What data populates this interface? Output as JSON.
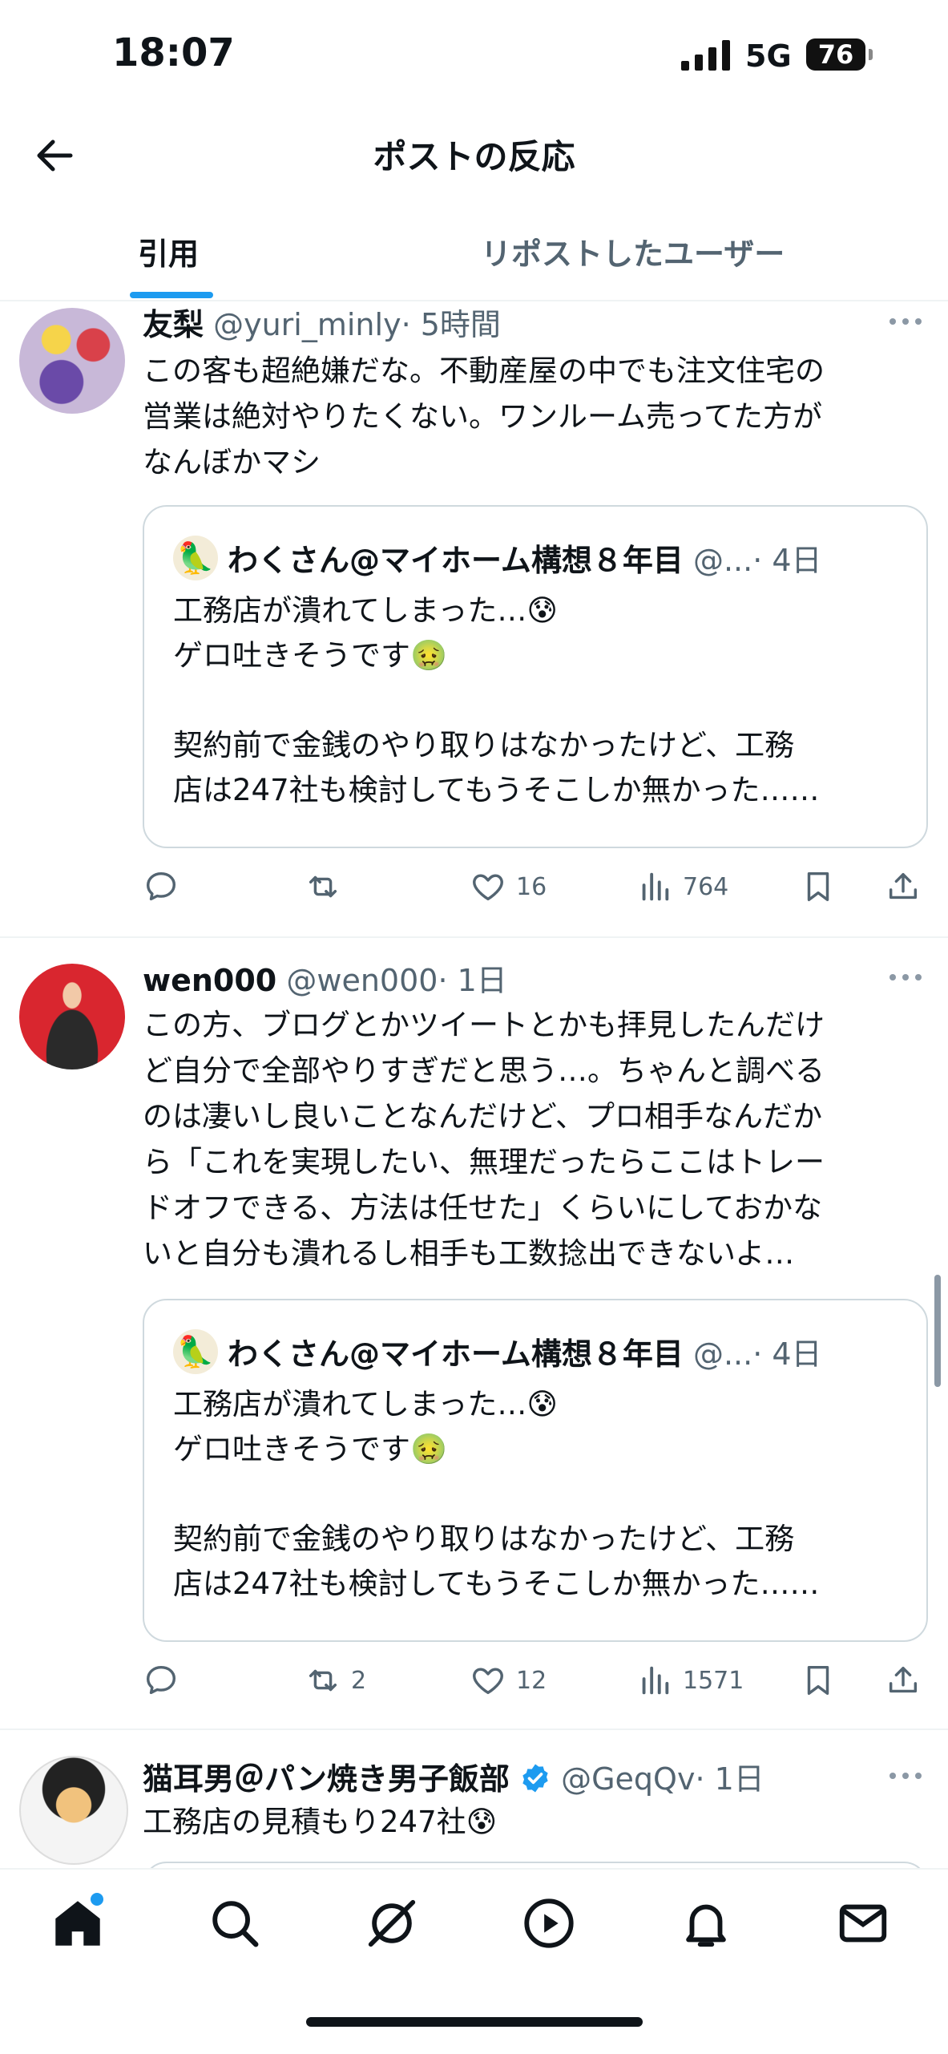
{
  "status_bar": {
    "time": "18:07",
    "network": "5G",
    "battery": "76"
  },
  "header": {
    "title": "ポストの反応"
  },
  "tabs": [
    {
      "label": "引用"
    },
    {
      "label": "リポストしたユーザー"
    }
  ],
  "posts": [
    {
      "name": "友梨",
      "handle": "@yuri_minly",
      "time": "· 5時間",
      "text": "この客も超絶嫌だな。不動産屋の中でも注文住宅の\n営業は絶対やりたくない。ワンルーム売ってた方が\nなんぼかマシ",
      "quote": {
        "name": "わくさん@マイホーム構想８年目",
        "handle": "@...",
        "time": "· 4日",
        "text": "工務店が潰れてしまった…😰\nゲロ吐きそうです🤢\n\n契約前で金銭のやり取りはなかったけど、工務\n店は247社も検討してもうそこしか無かった……"
      },
      "reposts": "",
      "likes": "16",
      "views": "764"
    },
    {
      "name": "wen000",
      "handle": "@wen000",
      "time": "· 1日",
      "text": "この方、ブログとかツイートとかも拝見したんだけ\nど自分で全部やりすぎだと思う…。ちゃんと調べる\nのは凄いし良いことなんだけど、プロ相手なんだか\nら「これを実現したい、無理だったらここはトレー\nドオフできる、方法は任せた」くらいにしておかな\nいと自分も潰れるし相手も工数捻出できないよ…",
      "quote": {
        "name": "わくさん@マイホーム構想８年目",
        "handle": "@...",
        "time": "· 4日",
        "text": "工務店が潰れてしまった…😰\nゲロ吐きそうです🤢\n\n契約前で金銭のやり取りはなかったけど、工務\n店は247社も検討してもうそこしか無かった……"
      },
      "reposts": "2",
      "likes": "12",
      "views": "1571"
    },
    {
      "name": "猫耳男＠パン焼き男子飯部",
      "handle": "@GeqQv",
      "time": "· 1日",
      "text": "工務店の見積もり247社😰"
    }
  ],
  "colors": {
    "accent": "#1d9bf0",
    "secondary_text": "#536471",
    "border": "#cfd9de"
  },
  "bottom_nav": [
    "home-icon",
    "search-icon",
    "grok-icon",
    "video-icon",
    "bell-icon",
    "mail-icon"
  ]
}
